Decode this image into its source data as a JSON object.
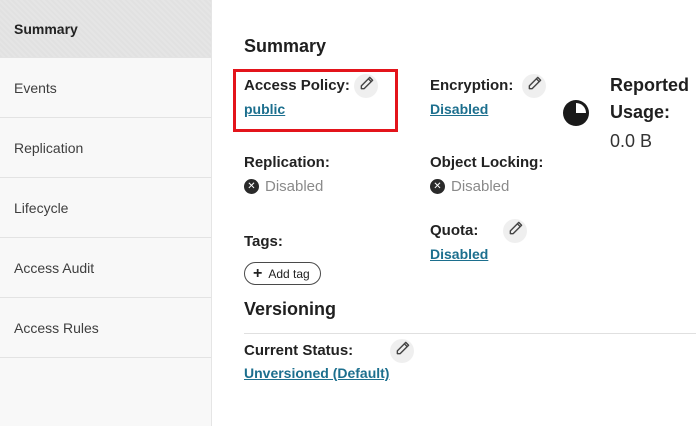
{
  "sidebar": {
    "items": [
      {
        "label": "Summary"
      },
      {
        "label": "Events"
      },
      {
        "label": "Replication"
      },
      {
        "label": "Lifecycle"
      },
      {
        "label": "Access Audit"
      },
      {
        "label": "Access Rules"
      }
    ]
  },
  "summary": {
    "title": "Summary",
    "access_policy": {
      "label": "Access Policy:",
      "value": "public"
    },
    "encryption": {
      "label": "Encryption:",
      "value": "Disabled"
    },
    "reported_usage": {
      "label_line1": "Reported",
      "label_line2": "Usage:",
      "value": "0.0 B"
    },
    "replication": {
      "label": "Replication:",
      "value": "Disabled"
    },
    "object_locking": {
      "label": "Object Locking:",
      "value": "Disabled"
    },
    "tags": {
      "label": "Tags:",
      "add_label": "Add tag"
    },
    "quota": {
      "label": "Quota:",
      "value": "Disabled"
    }
  },
  "versioning": {
    "title": "Versioning",
    "current_status": {
      "label": "Current Status:",
      "value": "Unversioned (Default)"
    }
  },
  "colors": {
    "link": "#1c6f8e",
    "highlight": "#e3141b",
    "muted": "#8a8a8a"
  }
}
